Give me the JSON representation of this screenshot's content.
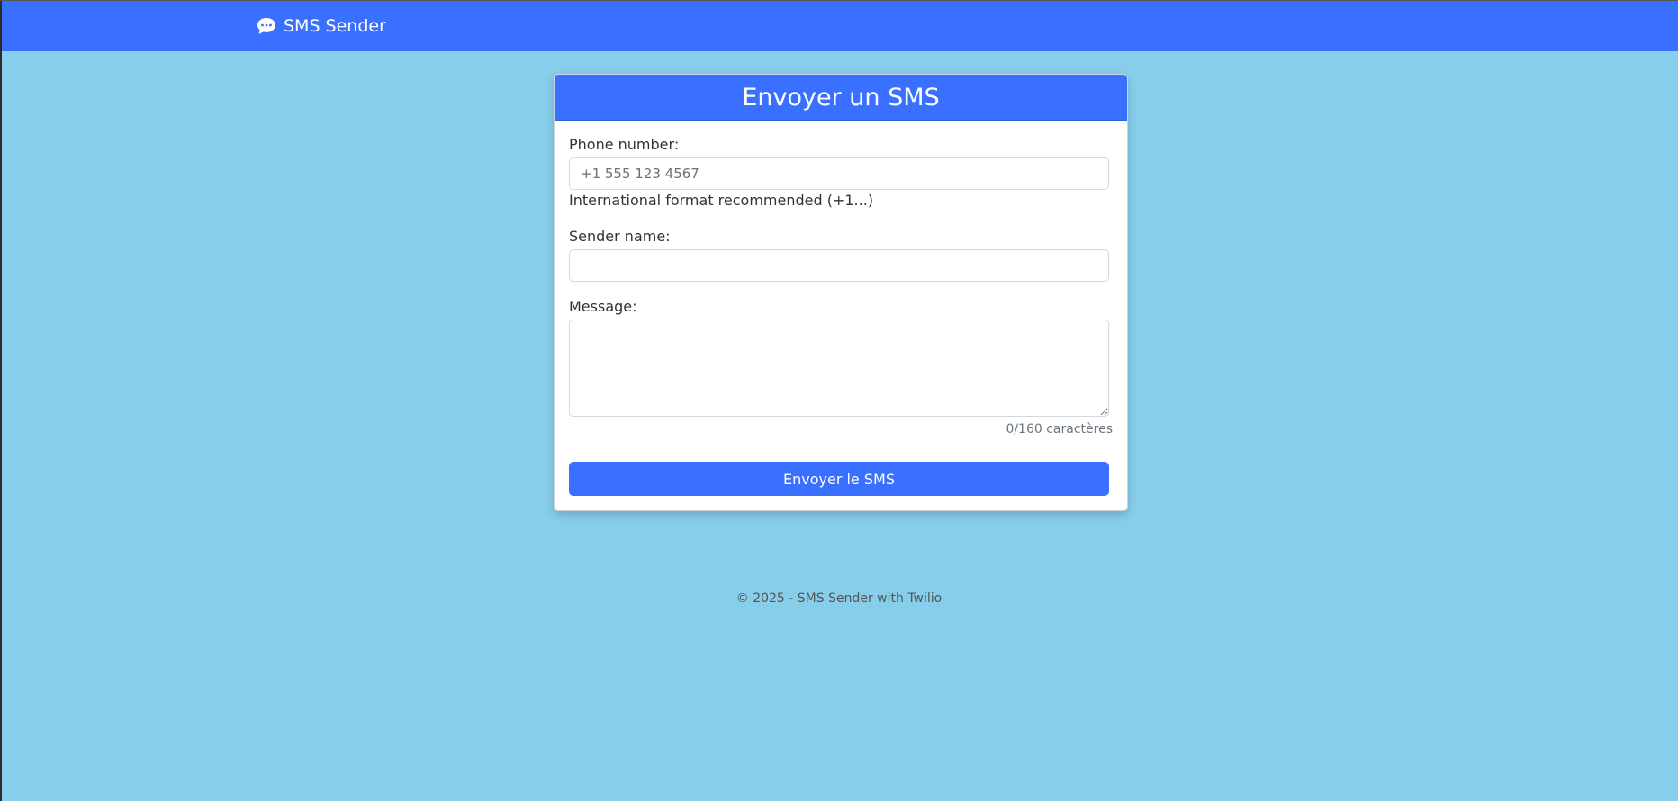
{
  "navbar": {
    "brand_icon": "chat-bubble-icon",
    "brand_text": "SMS Sender"
  },
  "form": {
    "title": "Envoyer un SMS",
    "phone_label": "Phone number:",
    "phone_placeholder": "+1 555 123 4567",
    "phone_value": "",
    "phone_hint": "International format recommended (+1...)",
    "sender_label": "Sender name:",
    "sender_value": "",
    "message_label": "Message:",
    "message_value": "",
    "char_counter": "0/160 caractères",
    "submit_label": "Envoyer le SMS"
  },
  "footer": {
    "text": "© 2025 - SMS Sender with Twilio"
  },
  "colors": {
    "background": "#87ceeb",
    "accent": "#3a70ff",
    "card": "#ffffff"
  }
}
